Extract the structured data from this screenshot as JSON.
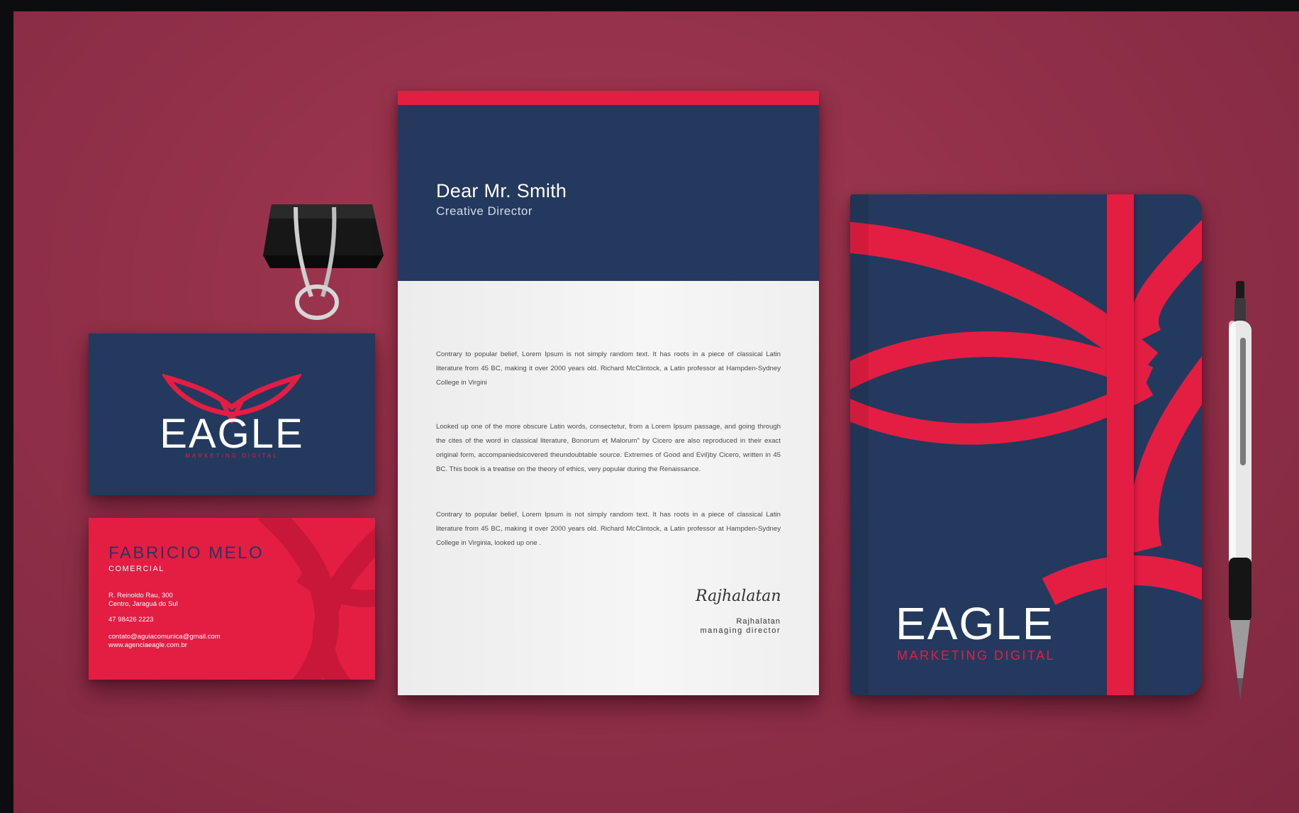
{
  "letterhead": {
    "recipient": "Dear Mr. Smith",
    "recipient_role": "Creative Director",
    "paragraphs": [
      "Contrary to popular belief, Lorem Ipsum is not simply random text. It has roots in a piece of classical Latin literature from 45 BC, making it over 2000 years old. Richard McClintock, a Latin professor at Hampden-Sydney College in Virgini",
      "Looked up one of the more obscure Latin words, consectetur, from a Lorem Ipsum passage, and going through the cites of the word in classical literature, Bonorum et Malorum\" by Cicero are also reproduced in their exact original form, accompaniedsicovered theundoubtable source. Extremes of Good and Evil)by Cicero, written in 45 BC. This book is a treatise on the theory of ethics, very popular during the Renaissance.",
      "Contrary to popular belief, Lorem Ipsum is not simply random text. It has roots in a piece of classical Latin literature from 45 BC, making it over 2000 years old. Richard McClintock, a Latin professor at Hampden-Sydney College in Virginia, looked up one ."
    ],
    "signature_script": "Rajhalatan",
    "signer_name": "Rajhalatan",
    "signer_role": "managing director"
  },
  "business_card_front": {
    "logo_word": "EAGLE",
    "logo_tagline": "MARKETING DIGITAL"
  },
  "business_card_back": {
    "name": "FABRICIO MELO",
    "role": "COMERCIAL",
    "address_line1": "R. Reinoldo Rau, 300",
    "address_line2": "Centro, Jaraguá do Sul",
    "phone": "47 98426 2223",
    "email": "contato@aguiacomunica@gmail.com",
    "website": "www.agenciaeagle.com.br"
  },
  "notebook": {
    "logo_word": "EAGLE",
    "logo_tagline": "MARKETING DIGITAL"
  },
  "colors": {
    "background": "#93304a",
    "navy": "#233a5e",
    "red": "#e41d43",
    "paper": "#f2f2f2"
  },
  "icons": [
    "binder-clip-icon",
    "eagle-logo-icon",
    "pen-icon"
  ]
}
